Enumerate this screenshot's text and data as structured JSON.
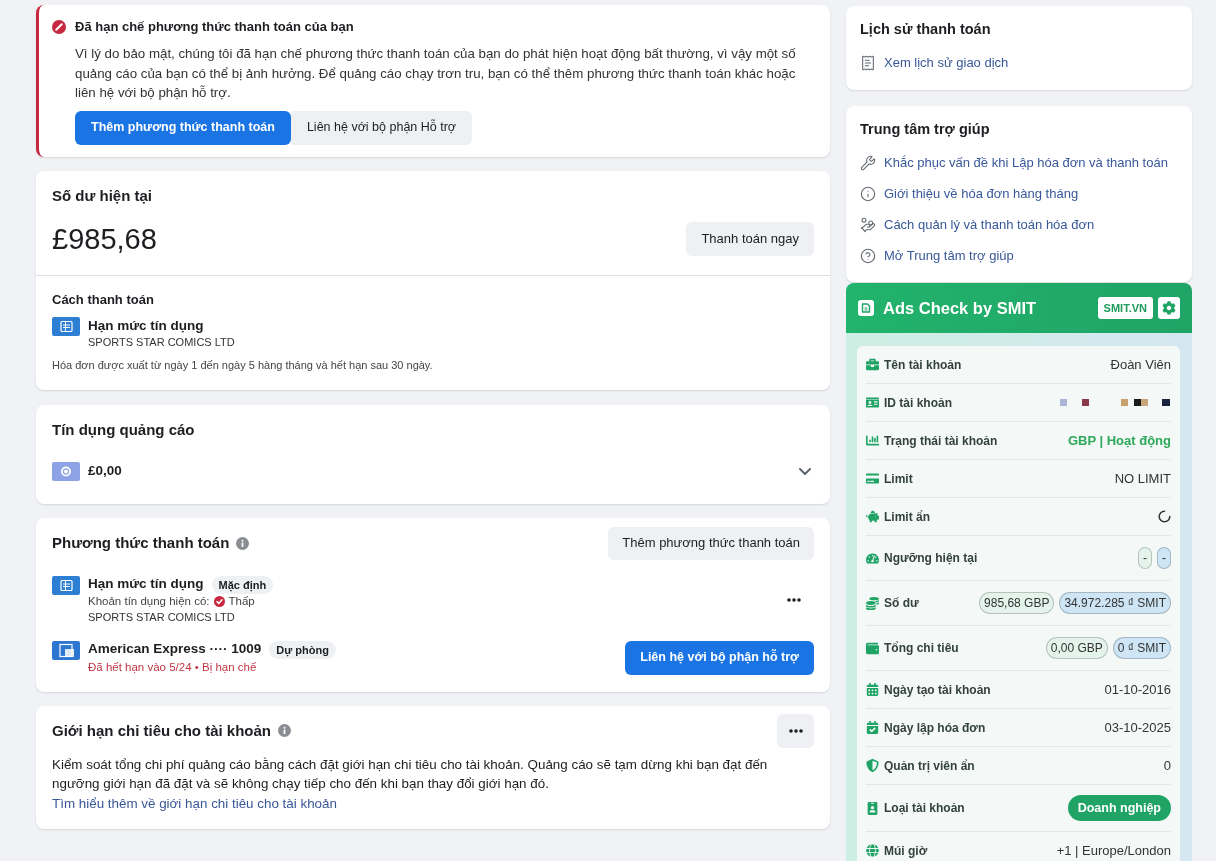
{
  "alert": {
    "title": "Đã hạn chế phương thức thanh toán của bạn",
    "message": "Vì lý do bảo mật, chúng tôi đã hạn chế phương thức thanh toán của bạn do phát hiện hoạt động bất thường, vì vậy một số quảng cáo của bạn có thể bị ảnh hưởng. Để quảng cáo chạy trơn tru, bạn có thể thêm phương thức thanh toán khác hoặc liên hệ với bộ phận hỗ trợ.",
    "buttons": [
      {
        "kind": "primary",
        "label": "Thêm phương thức thanh toán"
      },
      {
        "kind": "secondary",
        "label": "Liên hệ với bộ phận Hỗ trợ"
      }
    ]
  },
  "current_balance": {
    "title": "Số dư hiện tại",
    "amount": "£985,68",
    "button": "Thanh toán ngay",
    "payment_title": "Cách thanh toán",
    "method": {
      "name": "Hạn mức tín dụng",
      "company": "SPORTS STAR COMICS LTD"
    },
    "note": "Hóa đơn được xuất từ ngày 1 đến ngày 5 hàng tháng và hết hạn sau 30 ngày."
  },
  "ad_credit": {
    "title": "Tín dụng quảng cáo",
    "amount": "£0,00",
    "expanded": false
  },
  "payment_methods": {
    "title": "Phương thức thanh toán",
    "button": "Thêm phương thức thanh toán",
    "methods": [
      {
        "kind": "credit_line",
        "name": "Hạn mức tín dụng",
        "badge": "Mặc định",
        "detail_label": "Khoản tín dụng hiện có:",
        "detail_value": "Thấp",
        "company": "SPORTS STAR COMICS LTD",
        "action": {
          "kind": "menu"
        }
      },
      {
        "kind": "card",
        "name": "American Express ···· 1009",
        "badge": "Dự phòng",
        "status": "Đã hết hạn vào 5/24 • Bị hạn chế",
        "action": {
          "kind": "button",
          "label": "Liên hệ với bộ phận hỗ trợ"
        }
      }
    ]
  },
  "spending_limit": {
    "title": "Giới hạn chi tiêu cho tài khoản",
    "text": "Kiểm soát tổng chi phí quảng cáo bằng cách đặt giới hạn chi tiêu cho tài khoản. Quảng cáo sẽ tạm dừng khi bạn đạt đến ngưỡng giới hạn đã đặt và sẽ không chạy tiếp cho đến khi bạn thay đổi giới hạn đó.",
    "link": "Tìm hiểu thêm về giới hạn chi tiêu cho tài khoản"
  },
  "payment_history": {
    "title": "Lịch sử thanh toán",
    "link": "Xem lịch sử giao dịch"
  },
  "help_center": {
    "title": "Trung tâm trợ giúp",
    "links": [
      "Khắc phục vấn đề khi Lập hóa đơn và thanh toán",
      "Giới thiệu về hóa đơn hàng tháng",
      "Cách quản lý và thanh toán hóa đơn",
      "Mở Trung tâm trợ giúp"
    ]
  },
  "ads_check": {
    "title": "Ads Check by SMIT",
    "badge": "SMIT.VN",
    "rows": [
      {
        "label": "Tên tài khoản",
        "kind": "text",
        "value": "Đoàn Viên"
      },
      {
        "label": "ID tài khoản",
        "kind": "redacted"
      },
      {
        "label": "Trạng thái tài khoản",
        "kind": "status",
        "value": "GBP | Hoạt động"
      },
      {
        "label": "Limit",
        "kind": "text",
        "value": "NO LIMIT"
      },
      {
        "label": "Limit ẩn",
        "kind": "loading"
      },
      {
        "label": "Ngưỡng hiện tại",
        "kind": "pills",
        "pills": [
          {
            "text": "-",
            "color": "#e4f4ec"
          },
          {
            "text": "-",
            "color": "#cde5f4"
          }
        ]
      },
      {
        "label": "Số dư",
        "kind": "pills",
        "pills": [
          {
            "text": "985,68 GBP",
            "color": "#e4f4ec"
          },
          {
            "text": "34.972.285 ₫ SMIT",
            "color": "#cde5f4"
          }
        ]
      },
      {
        "label": "Tổng chi tiêu",
        "kind": "pills",
        "pills": [
          {
            "text": "0,00 GBP",
            "color": "#e4f4ec"
          },
          {
            "text": "0 ₫ SMIT",
            "color": "#cde5f4"
          }
        ]
      },
      {
        "label": "Ngày tạo tài khoản",
        "kind": "text",
        "value": "01-10-2016"
      },
      {
        "label": "Ngày lập hóa đơn",
        "kind": "text",
        "value": "03-10-2025"
      },
      {
        "label": "Quản trị viên ẩn",
        "kind": "text",
        "value": "0"
      },
      {
        "label": "Loại tài khoản",
        "kind": "badge",
        "value": "Doanh nghiệp"
      },
      {
        "label": "Múi giờ",
        "kind": "text",
        "value": "+1 | Europe/London"
      }
    ]
  }
}
